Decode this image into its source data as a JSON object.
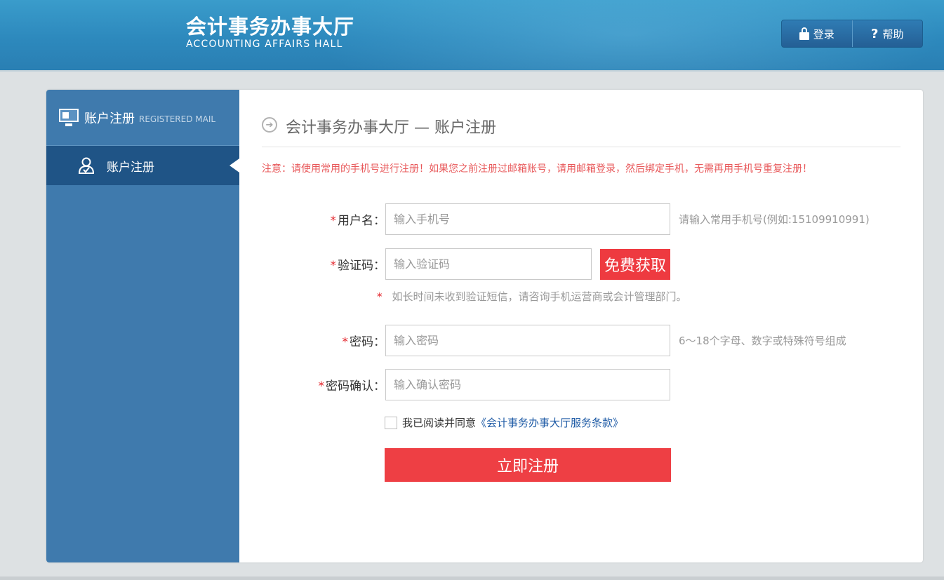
{
  "header": {
    "logo_cn": "会计事务办事大厅",
    "logo_en": "ACCOUNTING AFFAIRS HALL",
    "login_label": "登录",
    "help_label": "帮助",
    "help_icon": "?"
  },
  "sidebar": {
    "title": "账户注册",
    "subtitle": "REGISTERED MAIL",
    "items": [
      {
        "label": "账户注册",
        "icon": "user-icon",
        "active": true
      }
    ]
  },
  "content": {
    "title_arrow": "➔",
    "title": "会计事务办事大厅 — 账户注册",
    "notice": "注意：请使用常用的手机号进行注册！如果您之前注册过邮箱账号，请用邮箱登录，然后绑定手机，无需再用手机号重复注册！"
  },
  "form": {
    "required_mark": "*",
    "username": {
      "label": "用户名：",
      "placeholder": "输入手机号",
      "hint": "请输入常用手机号(例如:15109910991)"
    },
    "code": {
      "label": "验证码：",
      "placeholder": "输入验证码",
      "button": "免费获取"
    },
    "sms_hint": "如长时间未收到验证短信，请咨询手机运营商或会计管理部门。",
    "password": {
      "label": "密码：",
      "placeholder": "输入密码",
      "hint": "6～18个字母、数字或特殊符号组成"
    },
    "confirm": {
      "label": "密码确认：",
      "placeholder": "输入确认密码"
    },
    "agree_text": "我已阅读并同意",
    "agree_link": "《会计事务办事大厅服务条款》",
    "submit_label": "立即注册"
  },
  "colors": {
    "header_blue": "#2d89bd",
    "sidebar_blue": "#3f7aad",
    "sidebar_active": "#1f5486",
    "accent_red": "#ee3a40",
    "notice_red": "#e8585a",
    "link_blue": "#1d5aa5"
  }
}
